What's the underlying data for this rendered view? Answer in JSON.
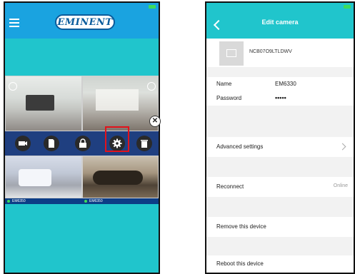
{
  "left_screen": {
    "logo_text": "EMINENT",
    "camera_labels": [
      "EM6350",
      "EM6350"
    ],
    "action_icons": [
      "camera-icon",
      "sd-card-icon",
      "lock-icon",
      "gear-icon",
      "trash-icon"
    ],
    "close_symbol": "✕"
  },
  "right_screen": {
    "title": "Edit camera",
    "device_id": "NCB07O9LTLDWV",
    "fields": [
      {
        "label": "Name",
        "value": "EM6330"
      },
      {
        "label": "Password",
        "value": "•••••"
      }
    ],
    "advanced_label": "Advanced settings",
    "reconnect_label": "Reconnect",
    "reconnect_status": "Online",
    "remove_label": "Remove this device",
    "reboot_label": "Reboot this device"
  },
  "colors": {
    "header_blue": "#1aa3e0",
    "teal": "#20c5cc",
    "action_bar": "#1f3f80",
    "highlight_red": "#e3121b",
    "status_green": "#3ddc5a"
  }
}
